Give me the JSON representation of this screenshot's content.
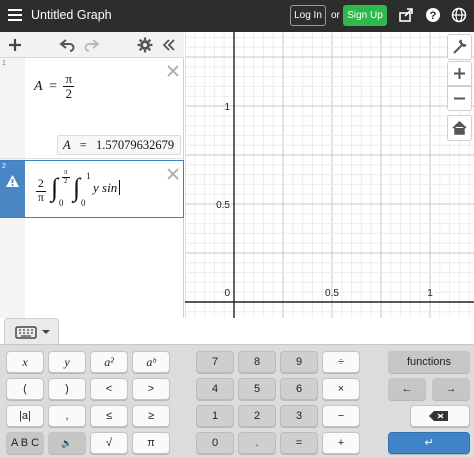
{
  "header": {
    "title": "Untitled Graph",
    "login_label": "Log In",
    "or_text": "or",
    "signup_label": "Sign Up",
    "icons": [
      "menu-icon",
      "share-icon",
      "help-icon",
      "globe-icon"
    ]
  },
  "expressions": [
    {
      "number": "1",
      "lhs": "A",
      "eq": "=",
      "num": "π",
      "den": "2",
      "evaluation": {
        "var": "A",
        "eq": "=",
        "value": "1.57079632679"
      }
    },
    {
      "number": "2",
      "coef_num": "2",
      "coef_den": "π",
      "int1_upper_num": "π",
      "int1_upper_den": "2",
      "int1_lower": "0",
      "int2_upper": "1",
      "int2_lower": "0",
      "body": "y sin",
      "status": "warning"
    }
  ],
  "graph": {
    "y_ticks": [
      "1",
      "0.5"
    ],
    "x_ticks": [
      "0",
      "0.5",
      "1"
    ]
  },
  "keypad": {
    "rows": [
      [
        "x",
        "y",
        "a²",
        "aᵇ"
      ],
      [
        "(",
        ")",
        "<",
        ">"
      ],
      [
        "|a|",
        ",",
        "≤",
        "≥"
      ],
      [
        "A B C",
        "🔊",
        "√",
        "π"
      ]
    ],
    "numbers": [
      [
        "7",
        "8",
        "9",
        "÷"
      ],
      [
        "4",
        "5",
        "6",
        "×"
      ],
      [
        "1",
        "2",
        "3",
        "−"
      ],
      [
        "0",
        ".",
        "=",
        "+"
      ]
    ],
    "functions_label": "functions",
    "left_arrow": "←",
    "right_arrow": "→",
    "enter": "↵"
  },
  "colors": {
    "header_bg": "#2d2d2d",
    "signup_green": "#2fb84c",
    "active_blue": "#4a86c4"
  }
}
